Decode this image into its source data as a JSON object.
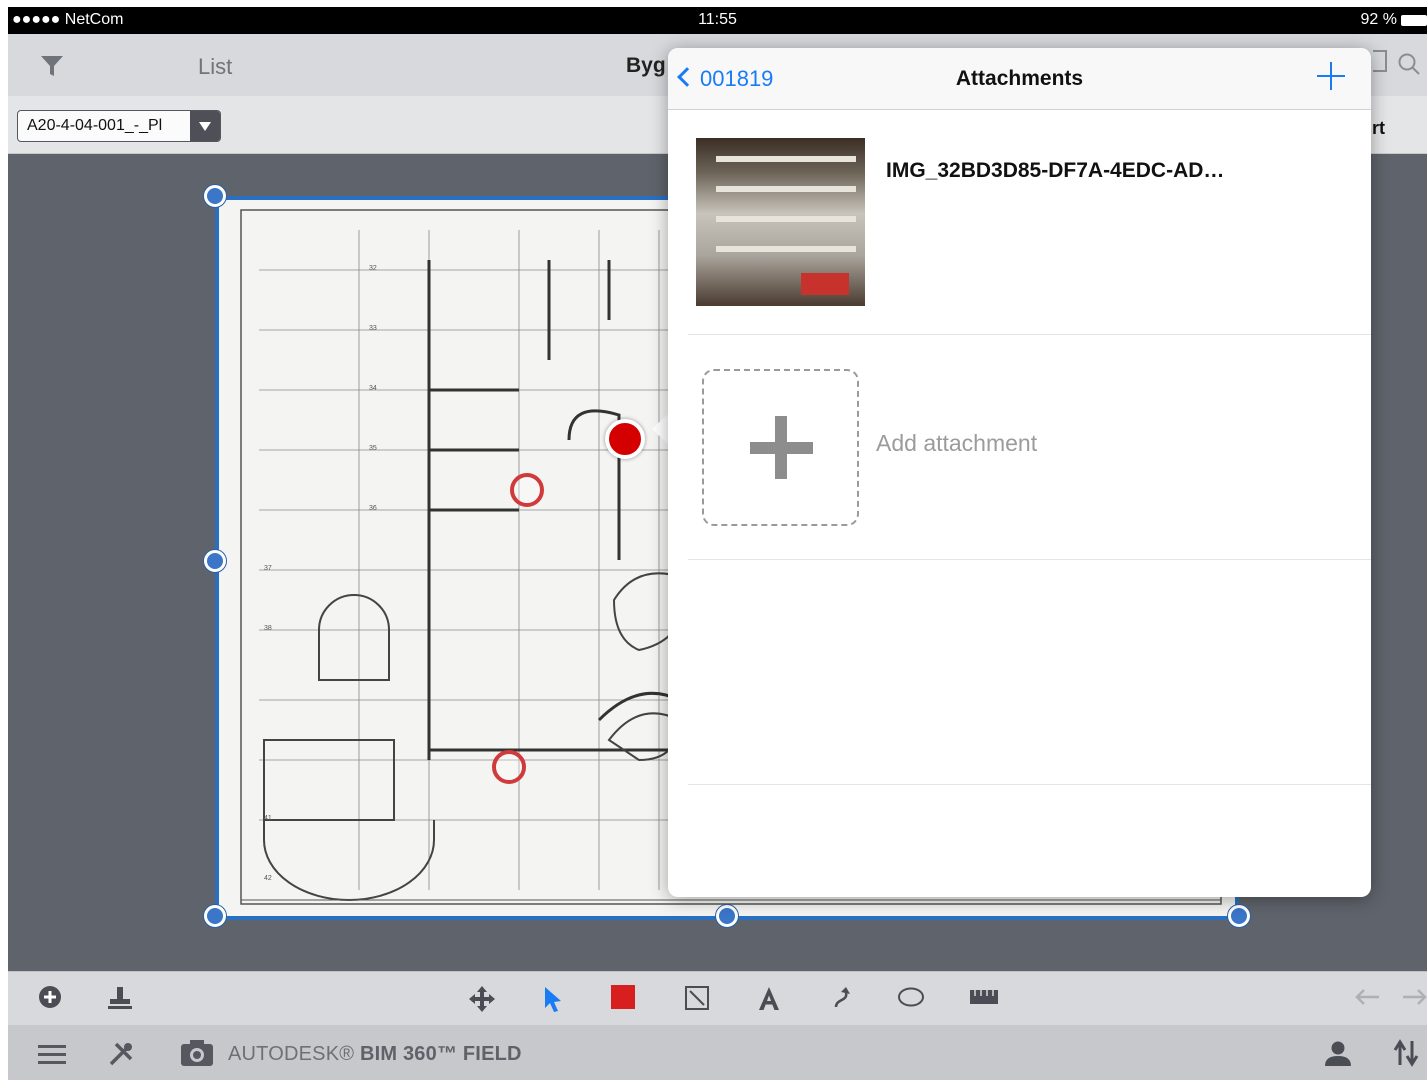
{
  "status_bar": {
    "carrier": "●●●●● NetCom",
    "time": "11:55",
    "battery": "92 %"
  },
  "nav": {
    "list_label": "List",
    "title_fragment": "Byg",
    "sub_right_fragment": "rt"
  },
  "sheet_select": {
    "value": "A20-4-04-001_-_Pl"
  },
  "popover": {
    "back_label": "001819",
    "title": "Attachments",
    "attachments": [
      {
        "name": "IMG_32BD3D85-DF7A-4EDC-AD…"
      }
    ],
    "add_label": "Add attachment"
  },
  "toolbar": {
    "tools": [
      "add-icon",
      "stamp-icon",
      "move-icon",
      "pointer-icon",
      "rectangle-icon",
      "box-icon",
      "text-icon",
      "curve-arrow-icon",
      "ellipse-icon",
      "ruler-icon",
      "undo-icon",
      "redo-icon"
    ]
  },
  "bottom_bar": {
    "brand_prefix": "AUTODESK® ",
    "brand_product": "BIM 360™ FIELD"
  },
  "colors": {
    "accent": "#1a7cf5",
    "selection": "#2a70c2",
    "marker": "#d40000",
    "background": "#5f636b"
  }
}
